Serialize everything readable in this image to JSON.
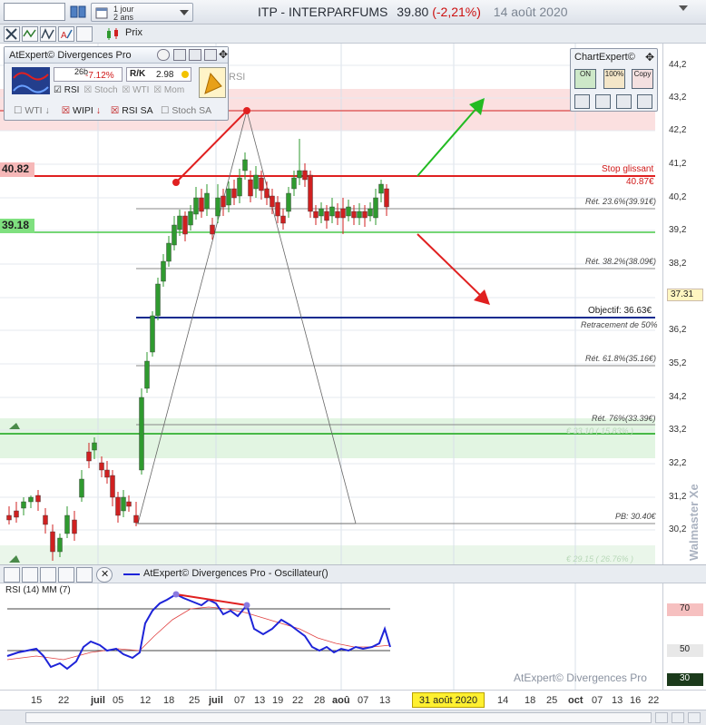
{
  "header": {
    "period_line1": "1 jour",
    "period_line2": "2 ans",
    "title": "ITP - INTERPARFUMS",
    "price": "39.80",
    "change": "(-2,21%)",
    "date": "14 août 2020"
  },
  "toolbar": {
    "price_label": "Prix"
  },
  "atexpert_panel": {
    "title": "AtExpert© Divergences Pro",
    "days": "26b",
    "pct": "-7.12%",
    "ratio": "2.98",
    "rsi_label": "RSI",
    "checks": [
      {
        "label": "RSI",
        "checked": true
      },
      {
        "label": "Stoch",
        "checked": false
      },
      {
        "label": "WTI",
        "checked": false
      },
      {
        "label": "Mom",
        "checked": false
      }
    ],
    "row2": [
      {
        "label": "WTI",
        "checked": false
      },
      {
        "label": "WIPI",
        "checked": true
      },
      {
        "label": "RSI SA",
        "checked": true
      },
      {
        "label": "Stoch SA",
        "checked": false
      }
    ],
    "ghost_label": "RSI"
  },
  "chartexpert": {
    "title": "ChartExpert©",
    "on": "ON",
    "pct": "100%",
    "copy": "Copy"
  },
  "price_axis": [
    "44,2",
    "43,2",
    "42,2",
    "41,2",
    "40,2",
    "39,2",
    "38,2",
    "37,2",
    "36,2",
    "35,2",
    "34,2",
    "33,2",
    "32,2",
    "31,2",
    "30,2"
  ],
  "current_price_tag": "37.31",
  "levels": {
    "resistance_tag": "40.82",
    "support_tag": "39.18",
    "stop_label": "Stop glissant",
    "stop_value": "40.87€",
    "ret236": "Rét. 23.6%(39.91€)",
    "ret382": "Rét. 38.2%(38.09€)",
    "objective": "Objectif: 36.63€",
    "retr50": "Retracement de 50%",
    "ret618": "Rét. 61.8%(35.16€)",
    "ret76": "Rét. 76%(33.39€)",
    "zone1": "€ 33.10 ( 15.83% )",
    "pb": "PB: 30.40€",
    "zone2": "€ 29.15 ( 26.76% )"
  },
  "watermark": "Walmaster Xe",
  "oscillator": {
    "title": "AtExpert© Divergences Pro - Oscillateur()",
    "rsi_label": "RSI (14) MM (7)",
    "axis": [
      "70",
      "50",
      "30"
    ],
    "footer": "AtExpert© Divergences Pro"
  },
  "x_axis": [
    "15",
    "22",
    "juil",
    "05",
    "12",
    "18",
    "25",
    "juil",
    "07",
    "13",
    "19",
    "22",
    "28",
    "aoû",
    "07",
    "13",
    "31 août 2020",
    "14",
    "18",
    "25",
    "oct",
    "07",
    "13",
    "16",
    "22"
  ],
  "colors": {
    "up": "#2f9a2f",
    "down": "#d02020",
    "resistance": "#e02020",
    "support": "#2fb82f",
    "objective": "#0b2a8f",
    "rsi": "#1d23d8"
  }
}
